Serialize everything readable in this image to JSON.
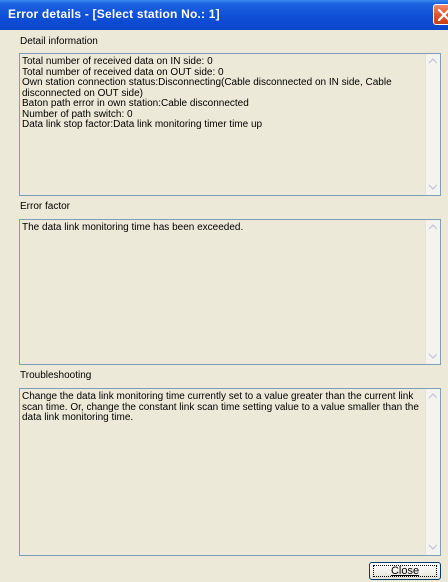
{
  "window": {
    "title": "Error details - [Select station No.:   1]",
    "close_icon": "close-x-icon"
  },
  "detail": {
    "label": "Detail information",
    "text": "Total number of received data on IN side: 0\nTotal number of received data on OUT side: 0\nOwn station connection status:Disconnecting(Cable disconnected on IN side, Cable disconnected on OUT side)\nBaton path error in own station:Cable disconnected\nNumber of path switch: 0\nData link stop factor:Data link monitoring timer time up"
  },
  "error_factor": {
    "label": "Error factor",
    "text": "The data link monitoring time has been exceeded."
  },
  "troubleshooting": {
    "label": "Troubleshooting",
    "text": "Change the data link monitoring time currently set to a value greater than the current link scan time. Or, change the constant link scan time setting value to a value smaller than the data link monitoring time."
  },
  "buttons": {
    "close_label": "Close"
  }
}
